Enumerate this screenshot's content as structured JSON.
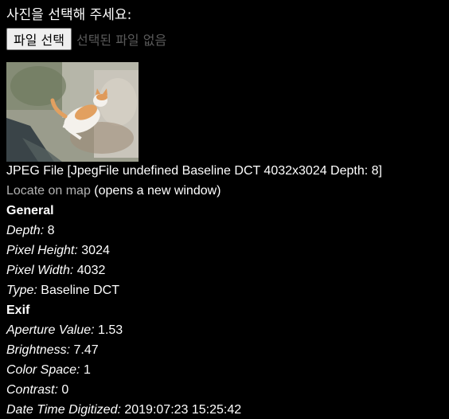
{
  "prompt": "사진을 선택해 주세요:",
  "file_input": {
    "button_label": "파일 선택",
    "status": "선택된 파일 없음"
  },
  "photo": {
    "subject": "cat lying on stone wall"
  },
  "file_info": "JPEG File [JpegFile undefined Baseline DCT 4032x3024 Depth: 8]",
  "map": {
    "link_text": "Locate on map",
    "note": " (opens a new window)"
  },
  "sections": [
    {
      "title": "General",
      "rows": [
        {
          "key": "Depth:",
          "value": " 8"
        },
        {
          "key": "Pixel Height:",
          "value": " 3024"
        },
        {
          "key": "Pixel Width:",
          "value": " 4032"
        },
        {
          "key": "Type:",
          "value": " Baseline DCT"
        }
      ]
    },
    {
      "title": "Exif",
      "rows": [
        {
          "key": "Aperture Value:",
          "value": " 1.53"
        },
        {
          "key": "Brightness:",
          "value": " 7.47"
        },
        {
          "key": "Color Space:",
          "value": " 1"
        },
        {
          "key": "Contrast:",
          "value": " 0"
        },
        {
          "key": "Date Time Digitized:",
          "value": " 2019:07:23 15:25:42"
        }
      ]
    }
  ]
}
